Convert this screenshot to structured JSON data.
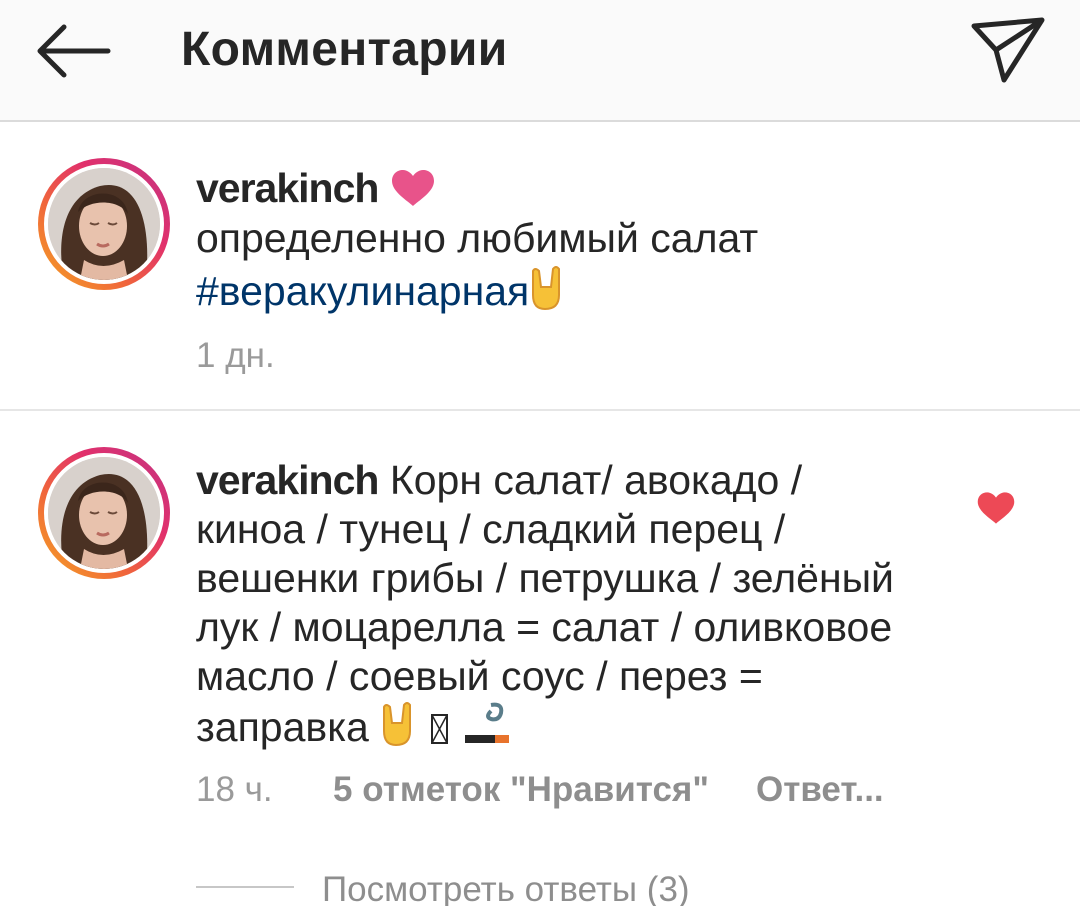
{
  "header": {
    "title": "Комментарии",
    "back_icon": "arrow-left-icon",
    "direct_icon": "paper-plane-icon"
  },
  "caption": {
    "username": "verakinch",
    "badge_icon": "heart-icon",
    "badge_color": "#e1306c",
    "text_line1": "определенно любимый салат",
    "hashtag": "#веракулинарная",
    "hashtag_color": "#003569",
    "time": "1 дн."
  },
  "comment": {
    "username": "verakinch",
    "lines": [
      "Корн салат/ авокадо /",
      "киноа / тунец / сладкий перец /",
      "вешенки грибы / петрушка / зелёный",
      "лук / моцарелла = салат / оливковое",
      "масло / соевый соус / перез =",
      "заправка"
    ],
    "time": "18 ч.",
    "likes": "5 отметок \"Нравится\"",
    "reply": "Ответ...",
    "liked_icon": "heart-filled-icon",
    "liked_color": "#ed4956",
    "view_replies": "Посмотреть ответы (3)"
  }
}
